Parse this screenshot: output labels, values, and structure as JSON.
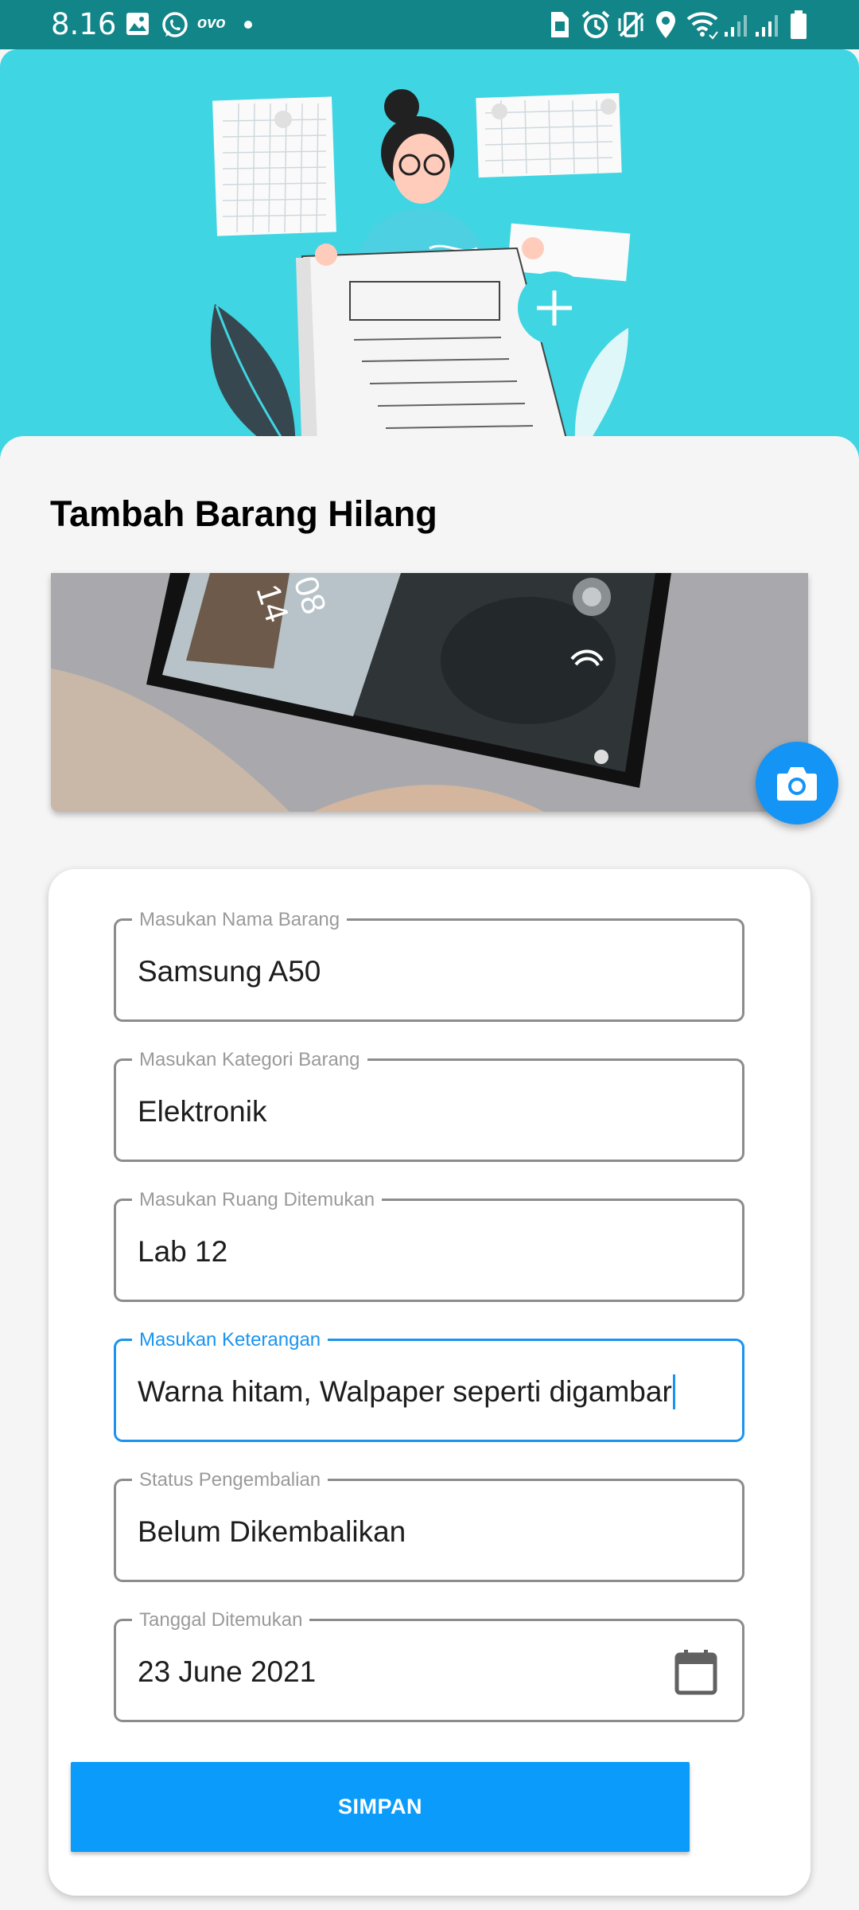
{
  "status_bar": {
    "time": "8.16",
    "left_icons": [
      "gallery-icon",
      "whatsapp-icon",
      "ovo-icon",
      "dot-icon"
    ],
    "ovo_label": "ovo",
    "right_icons": [
      "sim-icon",
      "alarm-icon",
      "vibrate-icon",
      "location-icon",
      "wifi-icon",
      "signal-icon",
      "signal-icon",
      "battery-icon"
    ]
  },
  "page": {
    "title": "Tambah Barang Hilang"
  },
  "form": {
    "fields": [
      {
        "label": "Masukan Nama Barang",
        "value": "Samsung A50"
      },
      {
        "label": "Masukan Kategori Barang",
        "value": "Elektronik"
      },
      {
        "label": "Masukan Ruang Ditemukan",
        "value": "Lab 12"
      },
      {
        "label": "Masukan Keterangan",
        "value": "Warna hitam, Walpaper seperti digambar"
      },
      {
        "label": "Status Pengembalian",
        "value": "Belum Dikembalikan"
      },
      {
        "label": "Tanggal Ditemukan",
        "value": "23 June 2021"
      }
    ],
    "save_label": "SIMPAN"
  },
  "colors": {
    "status_bar": "#128588",
    "header_bg": "#40d5e2",
    "accent": "#1a94f0",
    "button": "#0b9cfb"
  }
}
